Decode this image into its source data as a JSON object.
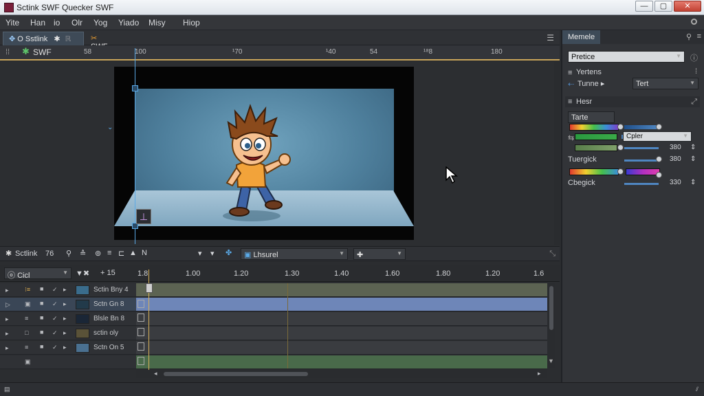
{
  "window": {
    "title": "Sctink SWF Quecker SWF",
    "btn_min": "—",
    "btn_max": "▢",
    "btn_close": "✕"
  },
  "menu": [
    "Yite",
    "Han",
    "io",
    "Olr",
    "Yog",
    "Yiado",
    "Misy",
    "Hiop"
  ],
  "tabs": [
    {
      "label": "O Sstlink",
      "active": true
    },
    {
      "label": "SWF",
      "active": false
    }
  ],
  "ruler": {
    "layer_label": "SWF",
    "ticks": [
      "58",
      "100",
      "¹70",
      "¹40",
      "54",
      "¹⁸8",
      "180"
    ]
  },
  "right_panel": {
    "tab": "Memele",
    "field_top": "Pretice",
    "section1": "Yertens",
    "row1_label": "Tunne  ▸",
    "row1_value": "Tert",
    "section2": "Hesr",
    "text_field": "Tarte",
    "color_field": "Cpler",
    "values": [
      "380",
      "380",
      "330"
    ],
    "label_strength": "Tuergick",
    "label_opacity": "Cbegick",
    "accent": "#4f86c1"
  },
  "timeline_toolbar": {
    "label": "Sctlink",
    "count": "76",
    "dropdown_label": "Lhsurel"
  },
  "timeline_header": {
    "filter": "Cicl",
    "add_label": "+ 15",
    "frame_labels": [
      "1.8",
      "1.00",
      "1.20",
      "1.30",
      "1.40",
      "1.60",
      "1.80",
      "1.20",
      "1.6"
    ]
  },
  "layers": [
    {
      "name": "Sctin Bny 4",
      "selected": false
    },
    {
      "name": "Sctn Gn 8",
      "selected": true
    },
    {
      "name": "Blsle Bn 8",
      "selected": false
    },
    {
      "name": "sctin oly",
      "selected": false
    },
    {
      "name": "Sctn On 5",
      "selected": false
    },
    {
      "name": "",
      "selected": false
    }
  ]
}
